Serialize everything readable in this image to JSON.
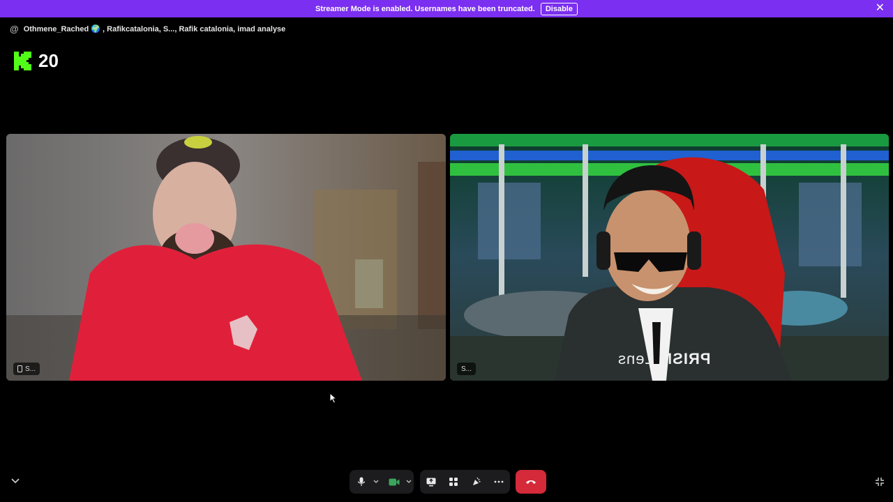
{
  "banner": {
    "message": "Streamer Mode is enabled. Usernames have been truncated.",
    "disable_label": "Disable",
    "close_glyph": "✕",
    "color": "#7b2ff0"
  },
  "header": {
    "at_symbol": "@",
    "participants": "Othmene_Rached 🌍 , Rafikcatalonia, S..., Rafik catalonia, imad analyse"
  },
  "kick": {
    "icon": "kick-logo-icon",
    "viewer_count": "20",
    "brand_color": "#53fc18"
  },
  "tiles": [
    {
      "label": "S...",
      "icon": "mobile-phone-icon"
    },
    {
      "label": "S...",
      "overlay_text_main": "PRISM",
      "overlay_text_sub": "Lens"
    }
  ],
  "controls": {
    "mic_icon": "microphone-icon",
    "camera_icon": "camera-icon",
    "share_icon": "screen-share-icon",
    "activities_icon": "activities-icon",
    "soundboard_icon": "soundboard-icon",
    "more_icon": "more-icon",
    "end_call_icon": "hang-up-icon",
    "end_call_color": "#d42a3a",
    "camera_active_color": "#3ba55d"
  }
}
